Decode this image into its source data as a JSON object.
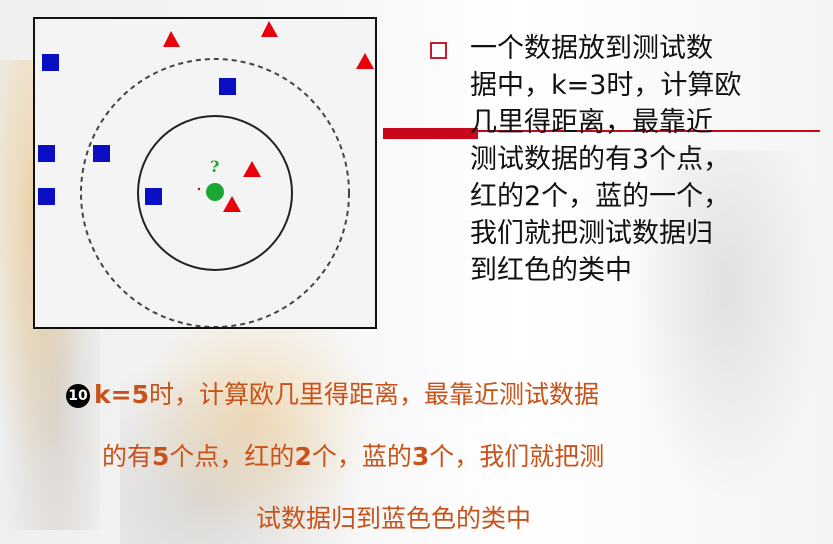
{
  "colors": {
    "red": "#e8000b",
    "blue": "#0a0fc4",
    "green": "#1aa832",
    "accent": "#c8081a",
    "bottom_text": "#c8531a"
  },
  "diagram": {
    "query_label": "?",
    "icons": [
      "red-triangle",
      "blue-square",
      "green-circle"
    ]
  },
  "description": {
    "text": "一个数据放到测试数\n据中，k=3时，计算欧\n几里得距离，最靠近\n测试数据的有3个点，\n红的2个，蓝的一个，\n我们就把测试数据归\n到红色的类中"
  },
  "bottom": {
    "badge": "10",
    "p1_bold": "k=5",
    "p1_rest": "时，计算欧几里得距离，最靠近测试数据",
    "p2_a": "的有",
    "p2_b": "5",
    "p2_c": "个点，红的",
    "p2_d": "2",
    "p2_e": "个，蓝的",
    "p2_f": "3",
    "p2_g": "个，我们就把测",
    "p3": "试数据归到蓝色色的类中"
  }
}
